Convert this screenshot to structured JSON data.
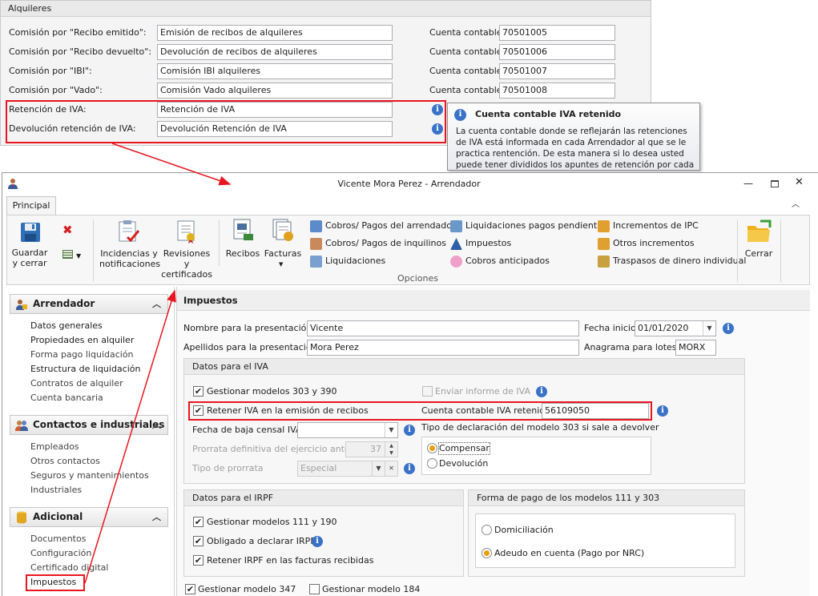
{
  "top_panel": {
    "title": "Alquileres",
    "rows": [
      {
        "label": "Comisión por \"Recibo emitido\":",
        "value": "Emisión de recibos de alquileres",
        "account_label": "Cuenta contable:",
        "account": "70501005"
      },
      {
        "label": "Comisión por \"Recibo devuelto\":",
        "value": "Devolución de recibos de alquileres",
        "account_label": "Cuenta contable:",
        "account": "70501006"
      },
      {
        "label": "Comisión por \"IBI\":",
        "value": "Comisión IBI alquileres",
        "account_label": "Cuenta contable:",
        "account": "70501007"
      },
      {
        "label": "Comisión por \"Vado\":",
        "value": "Comisión Vado alquileres",
        "account_label": "Cuenta contable:",
        "account": "70501008"
      },
      {
        "label": "Retención de IVA:",
        "value": "Retención de IVA"
      },
      {
        "label": "Devolución retención de IVA:",
        "value": "Devolución Retención de IVA"
      }
    ]
  },
  "tooltip": {
    "title": "Cuenta contable IVA retenido",
    "body": "La cuenta contable donde se reflejarán las retenciones de IVA está informada en cada Arrendador al que se le practica rentención. De esta manera si lo desea usted puede tener divididos los apuntes de retención por cada arrendador."
  },
  "window": {
    "title": "Vicente Mora Perez - Arrendador"
  },
  "ribbon": {
    "tab": "Principal",
    "save": "Guardar\ny cerrar",
    "incidencias": "Incidencias y\nnotificaciones",
    "revisiones": "Revisiones y\ncertificados",
    "recibos": "Recibos",
    "facturas": "Facturas",
    "links": [
      "Cobros/ Pagos del arrendador",
      "Cobros/ Pagos de inquilinos",
      "Liquidaciones",
      "Liquidaciones pagos pendientes",
      "Impuestos",
      "Cobros anticipados",
      "Incrementos de IPC",
      "Otros incrementos",
      "Traspasos de dinero individual"
    ],
    "group_label": "Opciones",
    "close": "Cerrar"
  },
  "nav": {
    "sections": [
      {
        "title": "Arrendador",
        "items": [
          "Datos generales",
          "Propiedades en alquiler",
          "Forma pago liquidación",
          "Estructura de liquidación",
          "Contratos de alquiler",
          "Cuenta bancaria"
        ]
      },
      {
        "title": "Contactos e industriales",
        "items": [
          "Empleados",
          "Otros contactos",
          "Seguros y mantenimientos",
          "Industriales"
        ]
      },
      {
        "title": "Adicional",
        "items": [
          "Documentos",
          "Configuración",
          "Certificado digital",
          "Impuestos"
        ]
      }
    ]
  },
  "content": {
    "title": "Impuestos",
    "nombre_label": "Nombre para la presentación:",
    "nombre": "Vicente",
    "apellidos_label": "Apellidos para la presentación:",
    "apellidos": "Mora Perez",
    "fecha_label": "Fecha inicio:",
    "fecha": "01/01/2020",
    "anagrama_label": "Anagrama para lotes:",
    "anagrama": "MORX",
    "iva": {
      "title": "Datos para el IVA",
      "gestionar": "Gestionar modelos 303 y 390",
      "enviar": "Enviar informe de IVA",
      "retener": "Retener IVA en la emisión de recibos",
      "cuenta_label": "Cuenta contable IVA retenido:",
      "cuenta": "56109050",
      "fecha_baja": "Fecha de baja censal IVA",
      "prorrata_def": "Prorrata definitiva del ejercicio anterior",
      "prorrata_val": "37",
      "tipo_prorrata": "Tipo de prorrata",
      "tipo_val": "Especial",
      "decl_title": "Tipo de declaración del modelo 303 si sale a devolver",
      "compensar": "Compensar",
      "devolucion": "Devolución"
    },
    "irpf": {
      "title": "Datos para el IRPF",
      "items": [
        "Gestionar modelos 111 y 190",
        "Obligado a declarar IRPF",
        "Retener IRPF en las facturas recibidas"
      ]
    },
    "pago": {
      "title": "Forma de pago de los modelos 111 y 303",
      "domiciliacion": "Domiciliación",
      "adeudo": "Adeudo en cuenta (Pago por NRC)"
    },
    "m347": "Gestionar modelo 347",
    "m184": "Gestionar modelo 184"
  },
  "colors": {
    "highlight": "#e8161f",
    "info": "#3a72c8",
    "radio": "#e8a000"
  }
}
